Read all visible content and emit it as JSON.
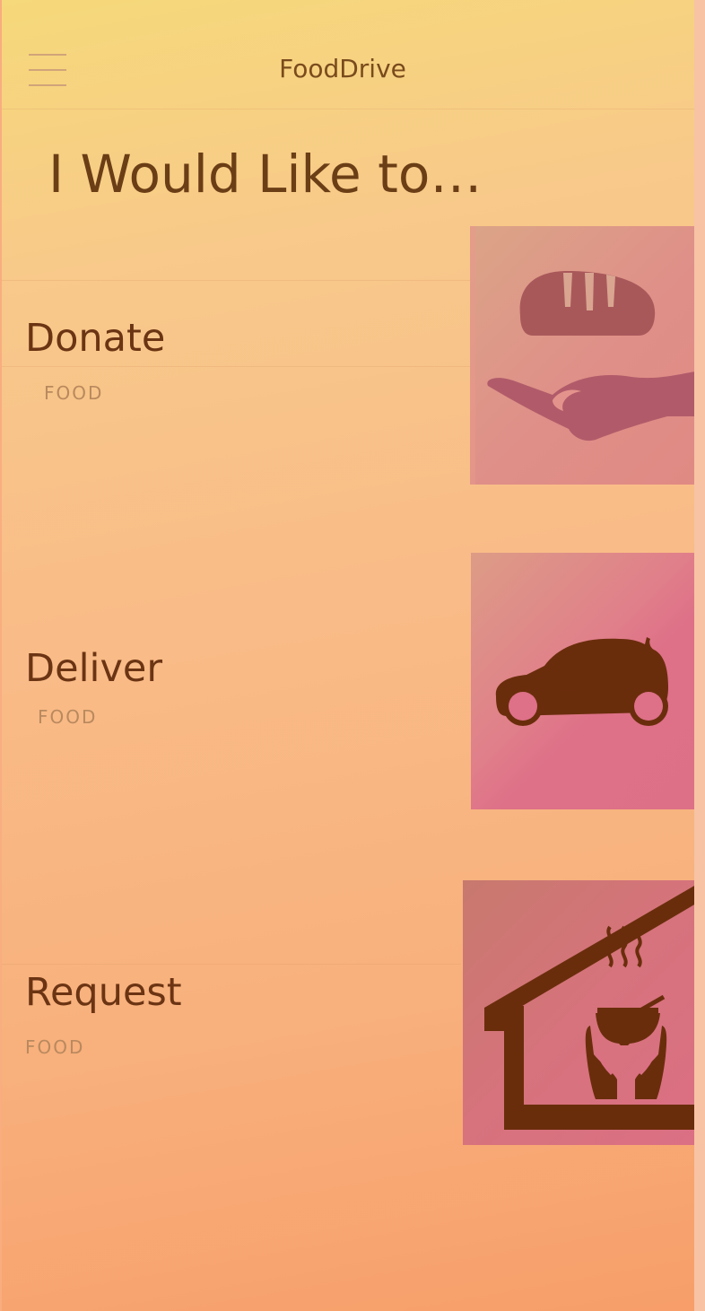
{
  "header": {
    "title": "FoodDrive",
    "menu_icon": "hamburger-menu-icon"
  },
  "main": {
    "heading": "I Would Like to…",
    "actions": [
      {
        "label": "Donate",
        "sublabel": "FOOD",
        "icon": "bread-on-hand-icon"
      },
      {
        "label": "Deliver",
        "sublabel": "FOOD",
        "icon": "car-icon"
      },
      {
        "label": "Request",
        "sublabel": "FOOD",
        "icon": "shelter-soup-bowl-icon"
      }
    ]
  },
  "colors": {
    "gradient_top": "#f6d97a",
    "gradient_bottom": "#f79e6a",
    "text_dark_brown": "#6b3413",
    "sublabel": "#b9895e",
    "icon_brown": "#6a2d0c",
    "tile_pink": "#de7088"
  }
}
